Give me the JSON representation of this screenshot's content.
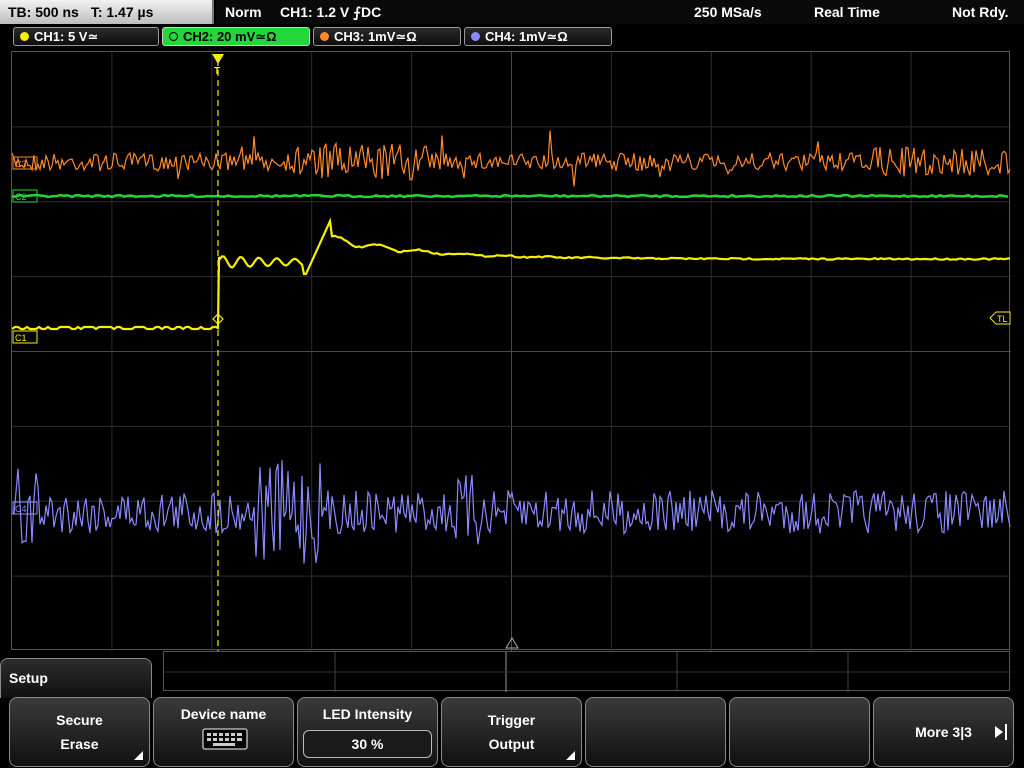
{
  "status": {
    "timebase": "TB: 500 ns",
    "trigger_time": "T: 1.47 µs",
    "mode": "Norm",
    "trigger_info": "CH1: 1.2 V ⨍DC",
    "sample_rate": "250 MSa/s",
    "acq_mode": "Real Time",
    "state": "Not Rdy."
  },
  "channels": [
    {
      "label": "CH1: 5 V≃",
      "color": "#f5f000"
    },
    {
      "label": "CH2: 20 mV≃Ω",
      "color": "#22d63c"
    },
    {
      "label": "CH3: 1mV≃Ω",
      "color": "#ff8a2a"
    },
    {
      "label": "CH4: 1mV≃Ω",
      "color": "#8a8aff"
    }
  ],
  "markers": {
    "c3": "C3",
    "c2": "C2",
    "c1": "C1",
    "c4": "C4",
    "trigger_level": "TL",
    "trigger_pos": "T"
  },
  "menu": {
    "title": "Setup",
    "softkeys": [
      {
        "line1": "Secure",
        "line2": "Erase"
      },
      {
        "line1": "Device name"
      },
      {
        "line1": "LED Intensity",
        "value": "30 %"
      },
      {
        "line1": "Trigger",
        "line2": "Output"
      },
      {
        "line1": ""
      },
      {
        "line1": ""
      },
      {
        "line1": "More 3|3"
      }
    ]
  },
  "colors": {
    "ch1": "#f5f000",
    "ch2": "#22d63c",
    "ch3": "#ff8a2a",
    "ch4": "#8a8aff"
  },
  "icons": {
    "keyboard": "keyboard-icon",
    "more": "arrow-right-icon"
  }
}
